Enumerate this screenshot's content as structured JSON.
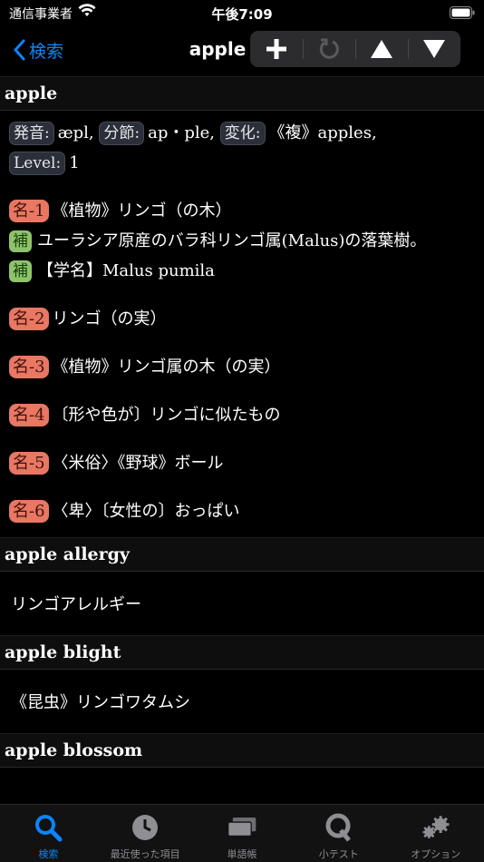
{
  "status_bar": {
    "carrier": "通信事業者",
    "time": "午後7:09"
  },
  "nav": {
    "back_label": "検索",
    "title": "apple"
  },
  "sections": {
    "apple": {
      "heading": "apple",
      "tags": {
        "pron": "発音:",
        "syll": "分節:",
        "infl": "変化:",
        "level": "Level:"
      },
      "pron_value": "æpl,",
      "syll_value": "ap・ple,",
      "infl_value": "《複》apples,",
      "level_value": "1",
      "senses": [
        {
          "pos": "名-1",
          "text": "《植物》リンゴ（の木）"
        },
        {
          "pos": "名-2",
          "text": "リンゴ（の実）"
        },
        {
          "pos": "名-3",
          "text": "《植物》リンゴ属の木（の実）"
        },
        {
          "pos": "名-4",
          "text": "〔形や色が〕リンゴに似たもの"
        },
        {
          "pos": "名-5",
          "text": "〈米俗〉《野球》ボール"
        },
        {
          "pos": "名-6",
          "text": "〈卑〉〔女性の〕おっぱい"
        }
      ],
      "notes": [
        {
          "tag": "補",
          "text": "ユーラシア原産のバラ科リンゴ属(Malus)の落葉樹。"
        },
        {
          "tag": "補",
          "text": "【学名】Malus pumila"
        }
      ]
    },
    "allergy": {
      "heading": "apple allergy",
      "text": "リンゴアレルギー"
    },
    "blight": {
      "heading": "apple blight",
      "text": "《昆虫》リンゴワタムシ"
    },
    "blossom": {
      "heading": "apple blossom"
    }
  },
  "tabs": [
    {
      "label": "検索",
      "icon": "magnifier-icon",
      "active": true
    },
    {
      "label": "最近使った項目",
      "icon": "clock-icon",
      "active": false
    },
    {
      "label": "単語帳",
      "icon": "cards-icon",
      "active": false
    },
    {
      "label": "小テスト",
      "icon": "quiz-icon",
      "active": false
    },
    {
      "label": "オプション",
      "icon": "gears-icon",
      "active": false
    }
  ],
  "colors": {
    "accent": "#0a84ff",
    "pos_badge": "#e87763",
    "note_badge": "#8dc46b"
  }
}
